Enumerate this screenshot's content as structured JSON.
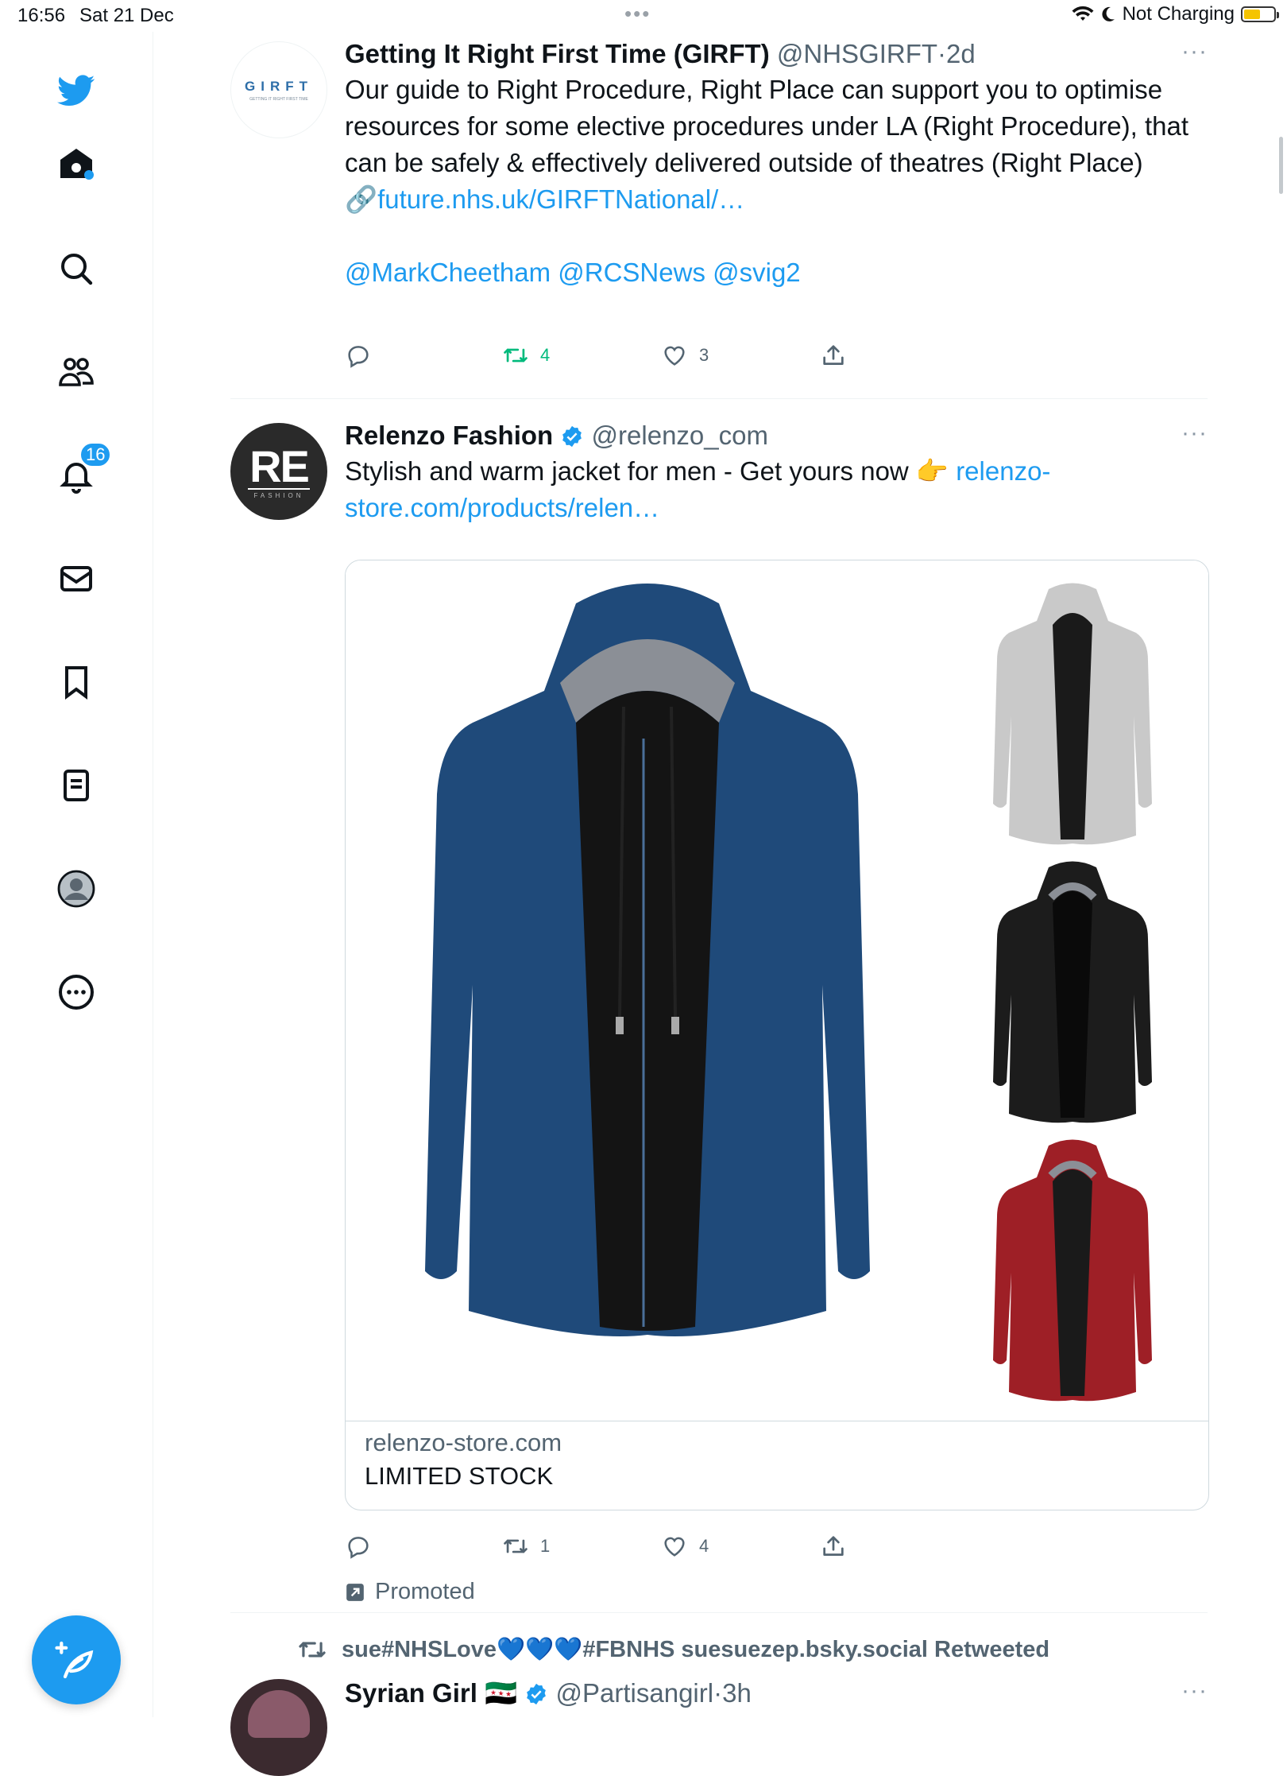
{
  "status_bar": {
    "time": "16:56",
    "date": "Sat 21 Dec",
    "charging": "Not Charging",
    "battery_level": 0.6
  },
  "sidebar": {
    "items": [
      {
        "name": "twitter-logo",
        "icon": "bird"
      },
      {
        "name": "home",
        "icon": "home"
      },
      {
        "name": "explore",
        "icon": "search"
      },
      {
        "name": "communities",
        "icon": "people"
      },
      {
        "name": "notifications",
        "icon": "bell"
      },
      {
        "name": "messages",
        "icon": "envelope"
      },
      {
        "name": "bookmarks",
        "icon": "bookmark"
      },
      {
        "name": "lists",
        "icon": "list"
      },
      {
        "name": "profile",
        "icon": "person"
      },
      {
        "name": "more",
        "icon": "more-circle"
      }
    ],
    "notifications_badge": "16",
    "compose_icon": "feather-plus"
  },
  "tweets": [
    {
      "name": "Getting It Right First Time (GIRFT)",
      "handle": "@NHSGIRFT",
      "sep": "·",
      "time": "2d",
      "avatar_text": "GIRFT",
      "avatar_subtext": "GETTING IT RIGHT FIRST TIME",
      "text_main": "Our guide to Right Procedure, Right Place can support you to optimise resources for some elective procedures under LA (Right Procedure), that can be safely & effectively delivered outside of theatres (Right Place)",
      "link_emoji": "🔗",
      "link": "future.nhs.uk/GIRFTNational/…",
      "mentions": "@MarkCheetham @RCSNews @svig2",
      "retweets": "4",
      "likes": "3",
      "more": "···"
    },
    {
      "name": "Relenzo Fashion",
      "handle": "@relenzo_com",
      "avatar_text": "RE",
      "avatar_subtext": "FASHION",
      "text_main": "Stylish and warm jacket for men - Get yours now 👉 ",
      "link": "relenzo-store.com/products/relen…",
      "card_domain": "relenzo-store.com",
      "card_title": "LIMITED STOCK",
      "retweets": "1",
      "likes": "4",
      "promoted": "Promoted",
      "more": "···"
    },
    {
      "retweeted_by": "sue#NHSLove💙💙💙#FBNHS suesuezep.bsky.social Retweeted",
      "name": "Syrian Girl",
      "flag": "🇸🇾",
      "handle": "@Partisangirl",
      "sep": "·",
      "time": "3h",
      "more": "···"
    }
  ],
  "colors": {
    "accent": "#1d9bf0",
    "retweet_active": "#00ba7c",
    "secondary_text": "#536471",
    "jacket_blue": "#1f4a7a",
    "jacket_gray": "#c9c9c9",
    "jacket_black": "#1c1c1c",
    "jacket_red": "#9e1f26"
  }
}
